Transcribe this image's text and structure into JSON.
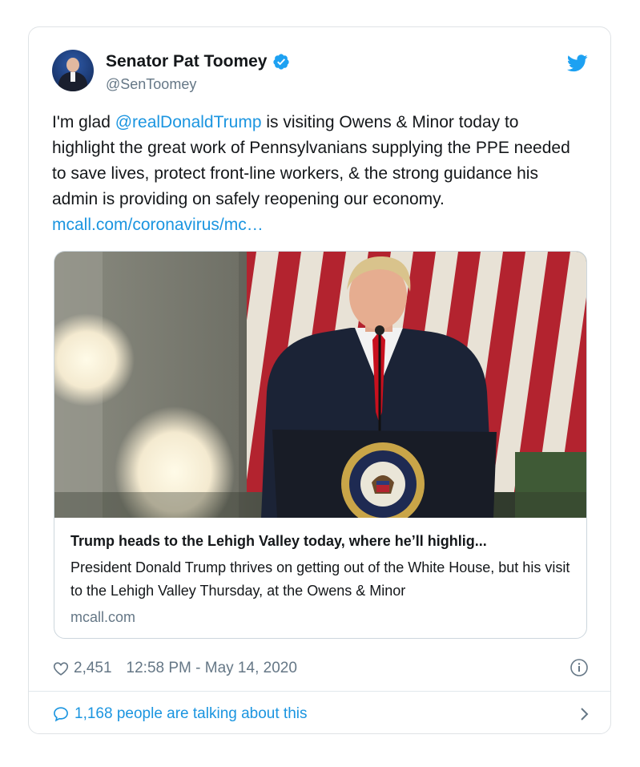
{
  "author": {
    "name": "Senator Pat Toomey",
    "handle": "@SenToomey",
    "verified": true
  },
  "tweet": {
    "prefix": "I'm glad ",
    "mention": "@realDonaldTrump",
    "body": " is visiting Owens & Minor today to highlight the great work of Pennsylvanians supplying the PPE needed to save lives, protect front-line workers, & the strong guidance his admin is providing on safely reopening our economy. ",
    "url": "mcall.com/coronavirus/mc…"
  },
  "link_card": {
    "title": "Trump heads to the Lehigh Valley today, where he’ll highlig...",
    "description": "President Donald Trump thrives on getting out of the White House, but his visit to the Lehigh Valley Thursday, at the Owens & Minor",
    "domain": "mcall.com"
  },
  "meta": {
    "likes": "2,451",
    "timestamp": "12:58 PM - May 14, 2020"
  },
  "footer": {
    "talking": "1,168 people are talking about this"
  },
  "colors": {
    "link": "#1b95e0",
    "secondary_text": "#657786",
    "verified_badge": "#1da1f2",
    "twitter_blue": "#1da1f2"
  },
  "icons": [
    "verified-badge-icon",
    "twitter-bird-icon",
    "heart-icon",
    "info-icon",
    "speech-bubble-icon",
    "chevron-right-icon"
  ]
}
